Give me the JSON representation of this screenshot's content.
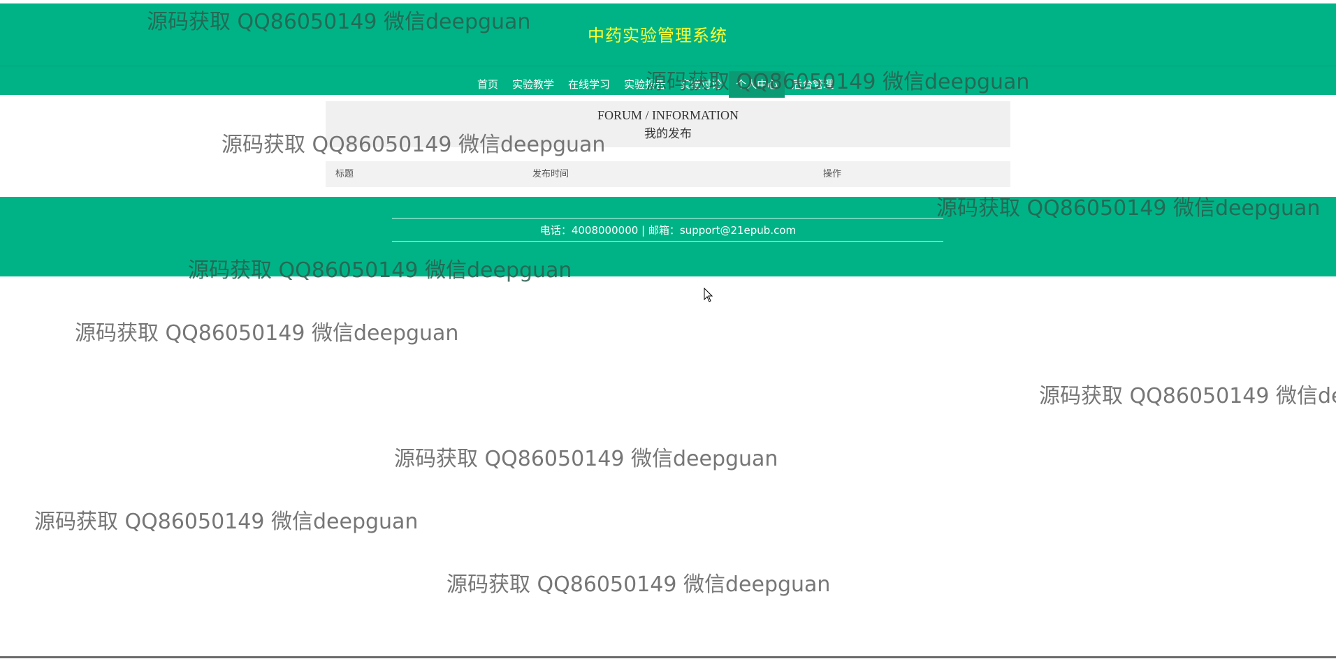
{
  "site": {
    "title": "中药实验管理系统"
  },
  "nav": {
    "items": [
      {
        "label": "首页"
      },
      {
        "label": "实验教学"
      },
      {
        "label": "在线学习"
      },
      {
        "label": "实验报告"
      },
      {
        "label": "实验讨论"
      },
      {
        "label": "个人中心"
      },
      {
        "label": "后台管理"
      }
    ],
    "active": "个人中心"
  },
  "section": {
    "title_en": "FORUM / INFORMATION",
    "title_cn": "我的发布"
  },
  "table": {
    "columns": [
      "标题",
      "发布时间",
      "操作"
    ]
  },
  "footer": {
    "contact": "电话：4008000000 | 邮箱：support@21epub.com"
  },
  "watermark": {
    "text": "源码获取 QQ86050149 微信deepguan"
  },
  "colors": {
    "brand_green": "#00b386",
    "title_yellow": "#ffff33"
  }
}
